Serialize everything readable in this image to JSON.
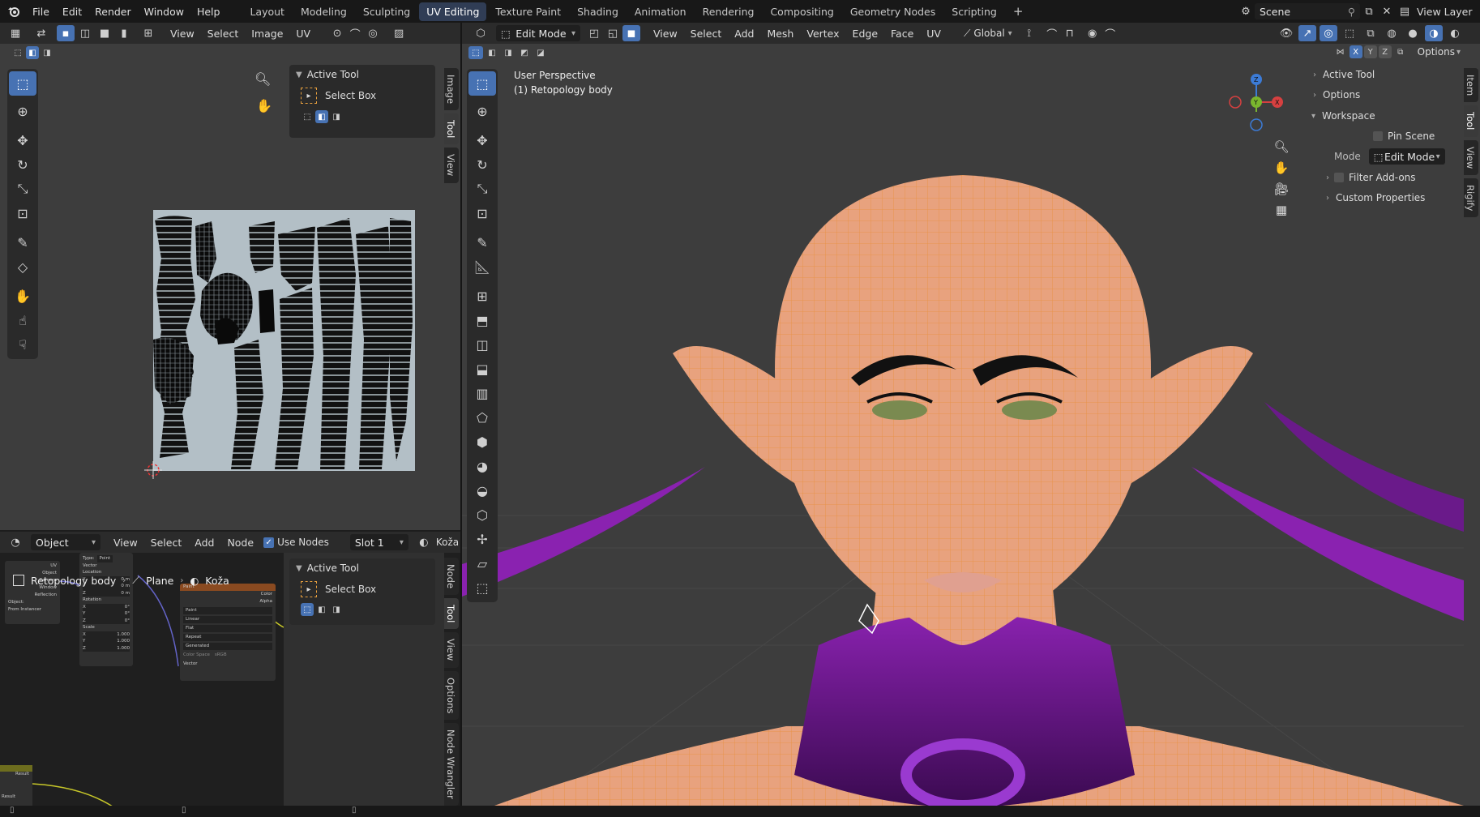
{
  "topbar": {
    "menus": [
      "File",
      "Edit",
      "Render",
      "Window",
      "Help"
    ],
    "workspaces": [
      "Layout",
      "Modeling",
      "Sculpting",
      "UV Editing",
      "Texture Paint",
      "Shading",
      "Animation",
      "Rendering",
      "Compositing",
      "Geometry Nodes",
      "Scripting"
    ],
    "active_workspace": "UV Editing",
    "add_workspace": "+",
    "scene_label": "Scene",
    "view_layer_label": "View Layer"
  },
  "uv_editor": {
    "menus": [
      "View",
      "Select",
      "Image",
      "UV"
    ],
    "side_tabs": [
      "Image",
      "Tool",
      "View"
    ],
    "active_tab": "Tool",
    "active_tool": {
      "title": "Active Tool",
      "tool_name": "Select Box"
    }
  },
  "node_editor": {
    "object_type": "Object",
    "menus": [
      "View",
      "Select",
      "Add",
      "Node"
    ],
    "use_nodes_label": "Use Nodes",
    "use_nodes_checked": true,
    "slot": "Slot 1",
    "material": "Koža",
    "breadcrumb": [
      "Retopology body",
      "Plane",
      "Koža"
    ],
    "side_tabs": [
      "Node",
      "Tool",
      "View",
      "Options",
      "Node Wrangler"
    ],
    "active_tool": {
      "title": "Active Tool",
      "tool_name": "Select Box"
    },
    "node_texcoord": {
      "outputs": [
        "UV",
        "Object",
        "Camera",
        "Window",
        "Reflection"
      ],
      "object_label": "Object:",
      "from_instancer": "From Instancer"
    },
    "node_mapping": {
      "type_label": "Type:",
      "type_value": "Point",
      "vector_label": "Vector",
      "location_label": "Location",
      "loc": [
        "0 m",
        "0 m",
        "0 m"
      ],
      "rotation_label": "Rotation",
      "rot": [
        "0°",
        "0°",
        "0°"
      ],
      "scale_label": "Scale",
      "scale": [
        "1.000",
        "1.000",
        "1.000"
      ],
      "axes": [
        "X",
        "Y",
        "Z"
      ]
    },
    "node_image": {
      "title": "Paint",
      "outputs": [
        "Color",
        "Alpha"
      ],
      "image_name": "Paint",
      "interpolation": "Linear",
      "projection": "Flat",
      "extension": "Repeat",
      "source": "Generated",
      "color_space_label": "Color Space",
      "color_space": "sRGB",
      "vector_socket": "Vector"
    },
    "result_label": "Result"
  },
  "viewport": {
    "mode": "Edit Mode",
    "menus": [
      "View",
      "Select",
      "Add",
      "Mesh",
      "Vertex",
      "Edge",
      "Face",
      "UV"
    ],
    "orientation": "Global",
    "options_label": "Options",
    "axes": [
      "X",
      "Y",
      "Z"
    ],
    "overlay_text_1": "User Perspective",
    "overlay_text_2": "(1) Retopology body",
    "side_tabs": [
      "Item",
      "Tool",
      "View",
      "Rigify"
    ],
    "active_tab": "Tool",
    "npanel": {
      "active_tool": "Active Tool",
      "options": "Options",
      "workspace": "Workspace",
      "pin_scene": "Pin Scene",
      "mode_label": "Mode",
      "mode_value": "Edit Mode",
      "filter_addons": "Filter Add-ons",
      "custom_properties": "Custom Properties"
    }
  },
  "colors": {
    "accent": "#4772b3",
    "skin": "#e8a27e",
    "wire": "#e8903f",
    "collar": "#7a1a9a"
  }
}
